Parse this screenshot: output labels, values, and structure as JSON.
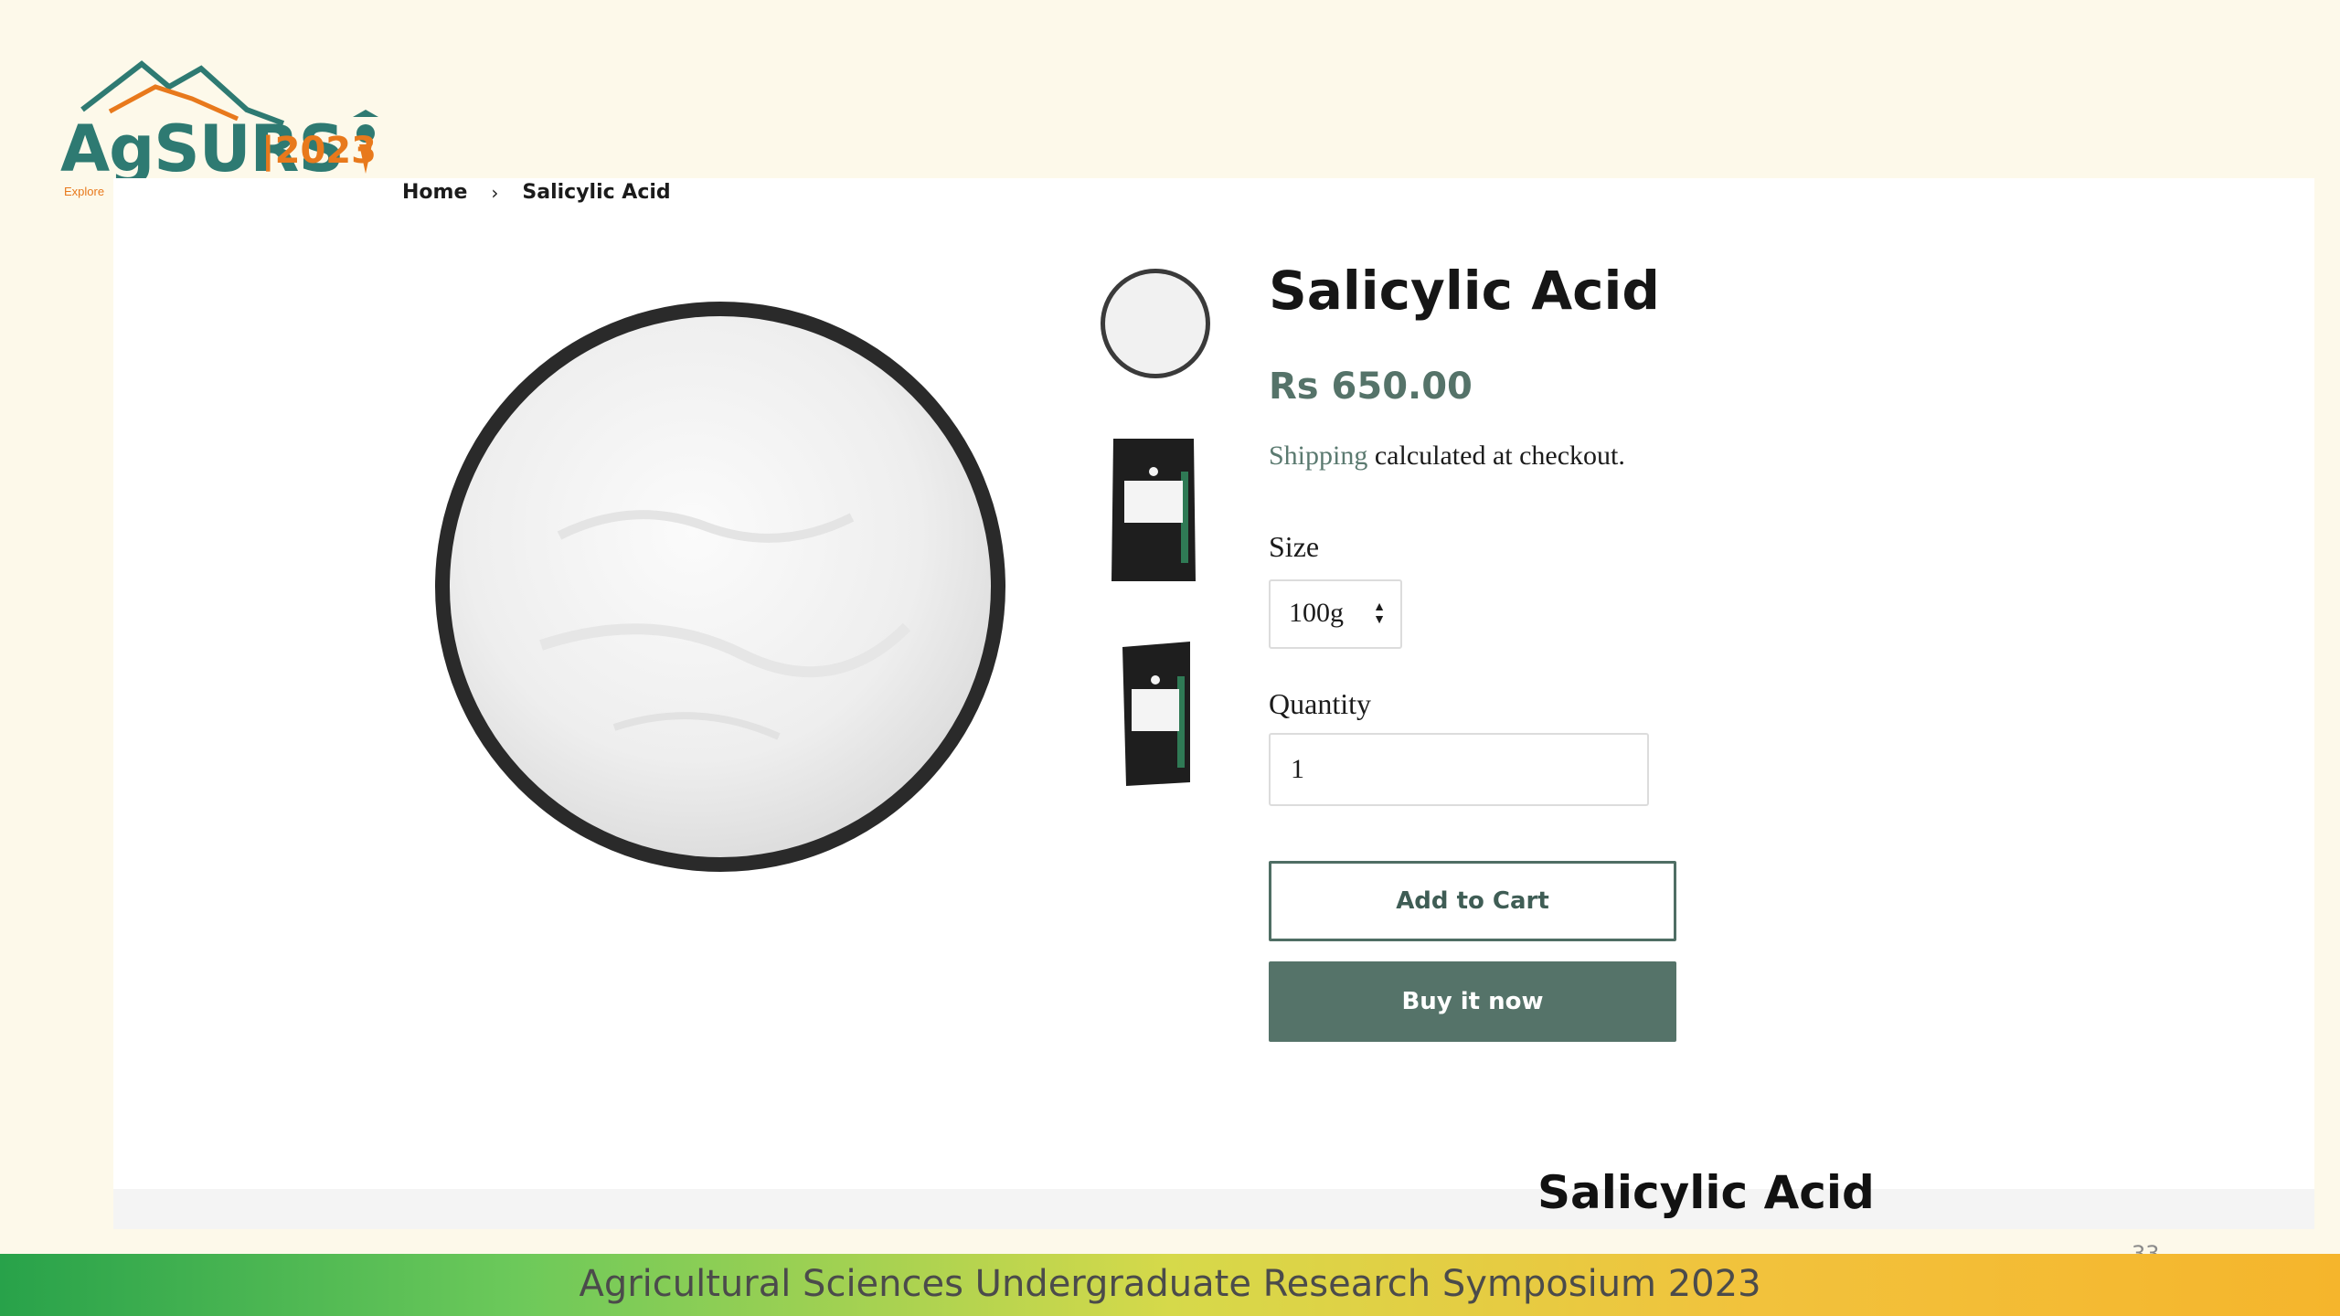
{
  "logo": {
    "word": "AgSURS",
    "year": "|2023",
    "tagline": "Explore"
  },
  "breadcrumb": {
    "home": "Home",
    "separator": "›",
    "current": "Salicylic Acid"
  },
  "product": {
    "title": "Salicylic Acid",
    "price": "Rs 650.00",
    "shipping_link": "Shipping",
    "shipping_rest": " calculated at checkout.",
    "size_label": "Size",
    "size_value": "100g",
    "quantity_label": "Quantity",
    "quantity_value": "1",
    "add_to_cart": "Add to Cart",
    "buy_now": "Buy it now"
  },
  "slide": {
    "caption": "Salicylic Acid",
    "footer": "Agricultural Sciences Undergraduate Research Symposium 2023",
    "number": "33"
  },
  "colors": {
    "accent": "#557369",
    "logo_teal": "#2e7a72",
    "logo_orange": "#e8791c",
    "slide_background": "#fdf9ea"
  }
}
